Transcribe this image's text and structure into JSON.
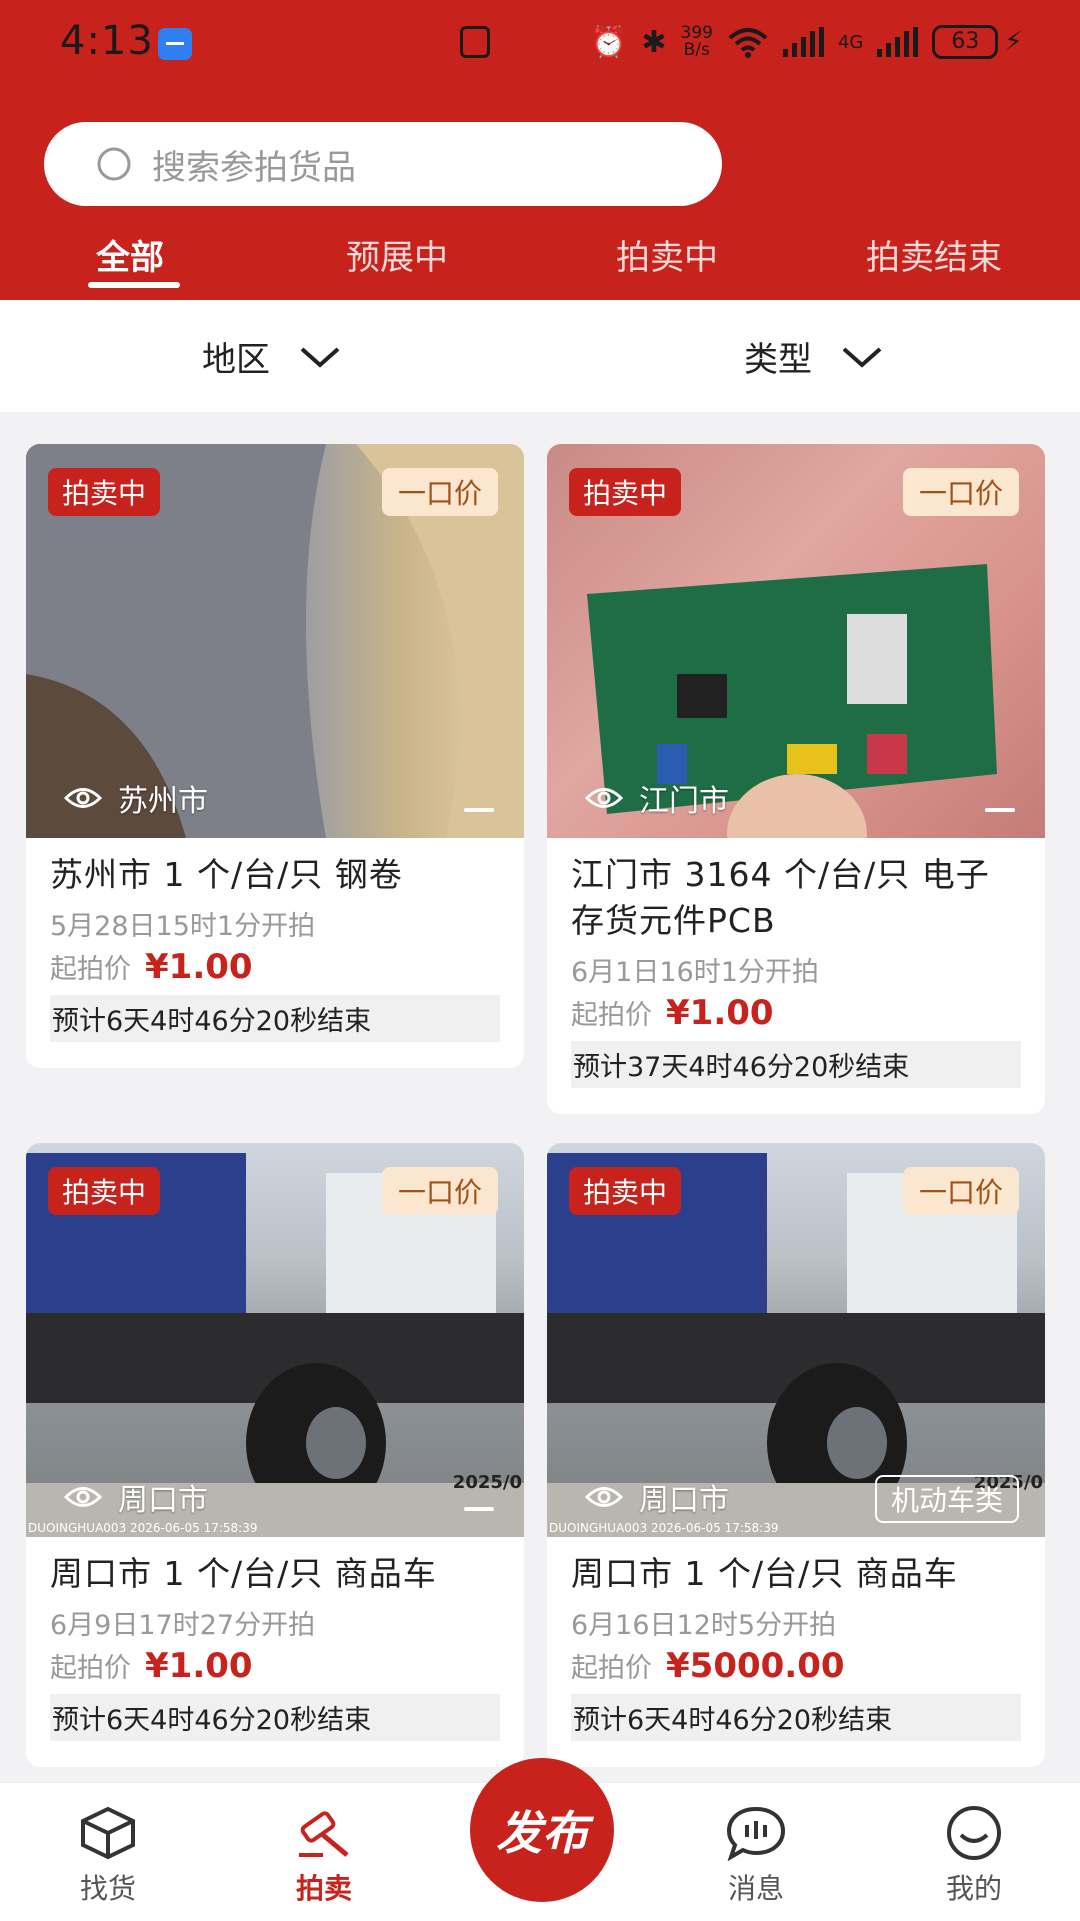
{
  "status_bar": {
    "time": "4:13",
    "net_speed_value": "399",
    "net_speed_unit": "B/s",
    "network": "4G",
    "battery": "63"
  },
  "search": {
    "placeholder": "搜索参拍货品"
  },
  "tabs": [
    {
      "label": "全部",
      "active": true
    },
    {
      "label": "预展中",
      "active": false
    },
    {
      "label": "拍卖中",
      "active": false
    },
    {
      "label": "拍卖结束",
      "active": false
    }
  ],
  "filters": {
    "region": "地区",
    "type": "类型"
  },
  "cards": [
    {
      "status": "拍卖中",
      "mode": "一口价",
      "city": "苏州市",
      "title": "苏州市 1 个/台/只 钢卷",
      "start": "5月28日15时1分开拍",
      "price_label": "起拍价",
      "price": "¥1.00",
      "end": "预计6天4时46分20秒结束",
      "image": "steel-coil"
    },
    {
      "status": "拍卖中",
      "mode": "一口价",
      "city": "江门市",
      "title": "江门市 3164 个/台/只 电子存货元件PCB",
      "start": "6月1日16时1分开拍",
      "price_label": "起拍价",
      "price": "¥1.00",
      "end": "预计37天4时46分20秒结束",
      "image": "pcb-board"
    },
    {
      "status": "拍卖中",
      "mode": "一口价",
      "city": "周口市",
      "title": "周口市 1 个/台/只 商品车",
      "start": "6月9日17时27分开拍",
      "price_label": "起拍价",
      "price": "¥1.00",
      "end": "预计6天4时46分20秒结束",
      "image": "truck-chassis",
      "watermark": "2025/0",
      "footer": "DUOINGHUA003 2026-06-05 17:58:39"
    },
    {
      "status": "拍卖中",
      "mode": "一口价",
      "city": "周口市",
      "title": "周口市 1 个/台/只 商品车",
      "start": "6月16日12时5分开拍",
      "price_label": "起拍价",
      "price": "¥5000.00",
      "end": "预计6天4时46分20秒结束",
      "image": "truck-chassis",
      "category": "机动车类",
      "watermark": "2025/0",
      "footer": "DUOINGHUA003 2026-06-05 17:58:39"
    }
  ],
  "nav": {
    "find": "找货",
    "auction": "拍卖",
    "publish": "发布",
    "messages": "消息",
    "mine": "我的",
    "active": "拍卖"
  },
  "colors": {
    "brand_red": "#c8221d",
    "fixed_price_bg": "#fbe6cf"
  }
}
